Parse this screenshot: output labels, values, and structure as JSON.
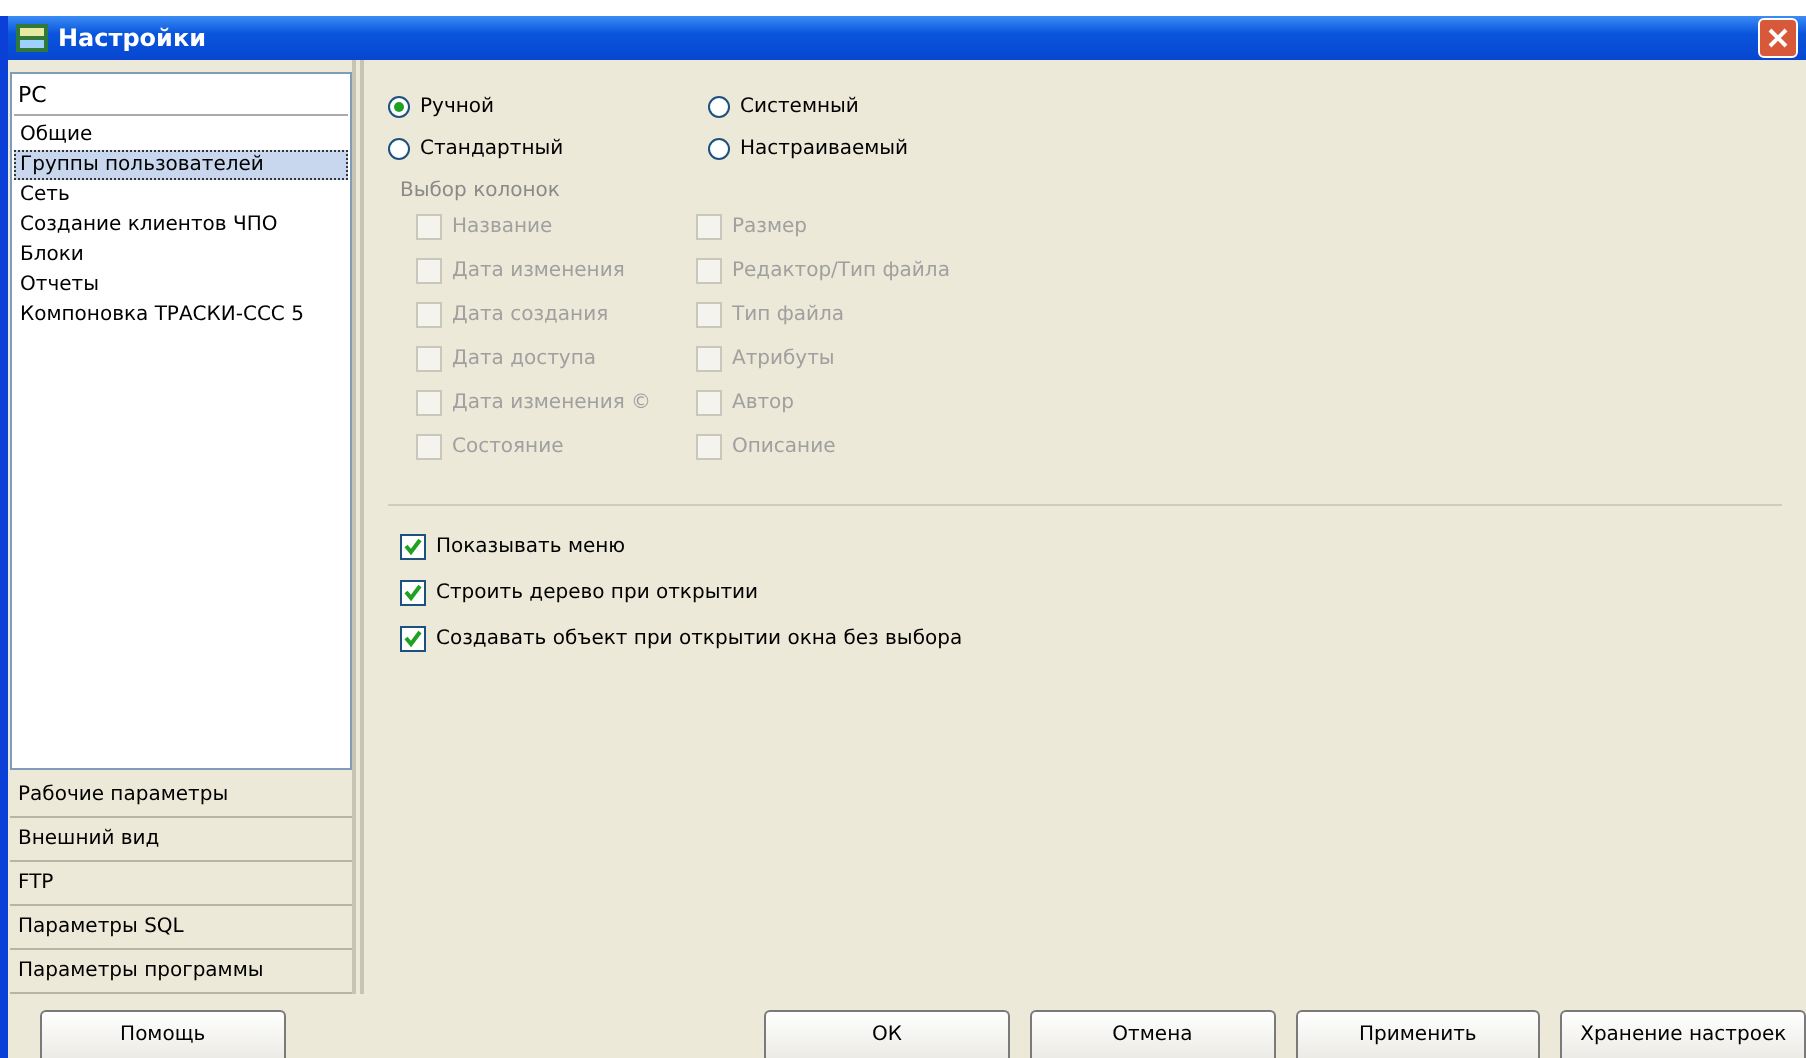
{
  "window": {
    "title": "Настройки"
  },
  "sidebar": {
    "header": "РС",
    "items": [
      {
        "label": "Общие",
        "selected": false
      },
      {
        "label": "Группы пользователей",
        "selected": true
      },
      {
        "label": "Сеть",
        "selected": false
      },
      {
        "label": "Создание клиентов ЧПО",
        "selected": false
      },
      {
        "label": "Блоки",
        "selected": false
      },
      {
        "label": "Отчеты",
        "selected": false
      },
      {
        "label": "Компоновка ТРАСКИ-ССС 5",
        "selected": false
      }
    ],
    "sections": [
      "Рабочие параметры",
      "Внешний вид",
      "FTP",
      "Параметры SQL",
      "Параметры программы"
    ]
  },
  "view_mode": [
    {
      "label": "Ручной",
      "selected": true
    },
    {
      "label": "Системный",
      "selected": false
    },
    {
      "label": "Стандартный",
      "selected": false
    },
    {
      "label": "Настраиваемый",
      "selected": false
    }
  ],
  "columns_group": {
    "title": "Выбор колонок",
    "items": [
      {
        "label": "Название",
        "checked": false,
        "disabled": true
      },
      {
        "label": "Размер",
        "checked": false,
        "disabled": true
      },
      {
        "label": "Дата изменения",
        "checked": false,
        "disabled": true
      },
      {
        "label": "Редактор/Тип файла",
        "checked": false,
        "disabled": true
      },
      {
        "label": "Дата создания",
        "checked": false,
        "disabled": true
      },
      {
        "label": "Тип файла",
        "checked": false,
        "disabled": true
      },
      {
        "label": "Дата доступа",
        "checked": false,
        "disabled": true
      },
      {
        "label": "Атрибуты",
        "checked": false,
        "disabled": true
      },
      {
        "label": "Дата изменения ©",
        "checked": false,
        "disabled": true
      },
      {
        "label": "Автор",
        "checked": false,
        "disabled": true
      },
      {
        "label": "Состояние",
        "checked": false,
        "disabled": true
      },
      {
        "label": "Описание",
        "checked": false,
        "disabled": true
      }
    ]
  },
  "options": [
    {
      "label": "Показывать меню",
      "checked": true
    },
    {
      "label": "Строить дерево при открытии",
      "checked": true
    },
    {
      "label": "Создавать объект при открытии окна без выбора",
      "checked": true
    }
  ],
  "buttons": [
    {
      "label": "Помощь",
      "kind": "left"
    },
    {
      "label": "ОК",
      "kind": "right"
    },
    {
      "label": "Отмена",
      "kind": "right"
    },
    {
      "label": "Применить",
      "kind": "right"
    },
    {
      "label": "Хранение настроек",
      "kind": "right"
    }
  ]
}
